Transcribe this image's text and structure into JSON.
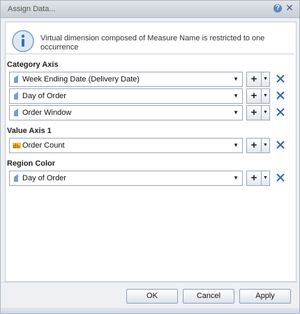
{
  "dialog": {
    "title": "Assign Data...",
    "help_glyph": "?",
    "close_glyph": "✕"
  },
  "info": {
    "icon": "info-icon",
    "message": "Virtual dimension composed of Measure Name is restricted to one occurrence"
  },
  "sections": {
    "category_axis": {
      "label": "Category Axis",
      "items": [
        {
          "icon": "dimension-icon",
          "text": "Week Ending Date (Delivery Date)"
        },
        {
          "icon": "dimension-icon",
          "text": "Day of Order"
        },
        {
          "icon": "dimension-icon",
          "text": "Order Window"
        }
      ]
    },
    "value_axis_1": {
      "label": "Value Axis 1",
      "items": [
        {
          "icon": "measure-icon",
          "text": "Order Count"
        }
      ]
    },
    "region_color": {
      "label": "Region Color",
      "items": [
        {
          "icon": "dimension-icon",
          "text": "Day of Order"
        }
      ]
    }
  },
  "controls": {
    "add_glyph": "+",
    "caret_glyph": "▼",
    "dropdown_glyph": "▼"
  },
  "buttons": {
    "ok": "OK",
    "cancel": "Cancel",
    "apply": "Apply"
  },
  "colors": {
    "remove_x": "#2f66b3",
    "dimension_icon": "#7a9bcc",
    "measure_icon": "#e0a020"
  }
}
